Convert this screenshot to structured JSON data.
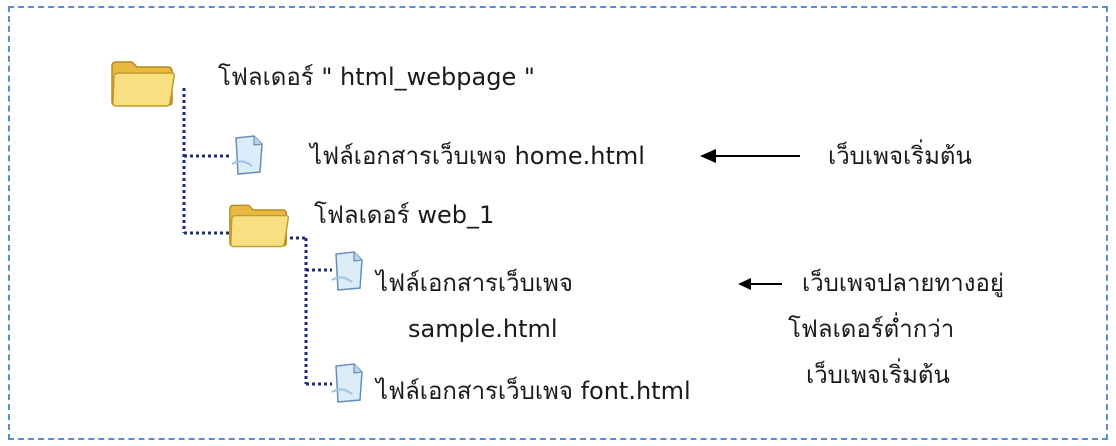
{
  "tree": {
    "root_folder_label": "โฟลเดอร์  \" html_webpage \"",
    "home_file_label": "ไฟล์เอกสารเว็บเพจ  home.html",
    "sub_folder_label": "โฟลเดอร์  web_1",
    "sample_file_line1": "ไฟล์เอกสารเว็บเพจ",
    "sample_file_line2": "sample.html",
    "font_file_label": "ไฟล์เอกสารเว็บเพจ  font.html"
  },
  "notes": {
    "home_note": "เว็บเพจเริ่มต้น",
    "sample_note_line1": "เว็บเพจปลายทางอยู่",
    "sample_note_line2": "โฟลเดอร์ต่ำกว่า",
    "sample_note_line3": "เว็บเพจเริ่มต้น"
  },
  "colors": {
    "frame_border": "#5b8ccc",
    "connector": "#1f2a7a",
    "folder": "#f3d46a",
    "document": "#d8eaf8"
  },
  "icons": [
    "folder-icon",
    "document-icon",
    "left-arrow-icon"
  ]
}
